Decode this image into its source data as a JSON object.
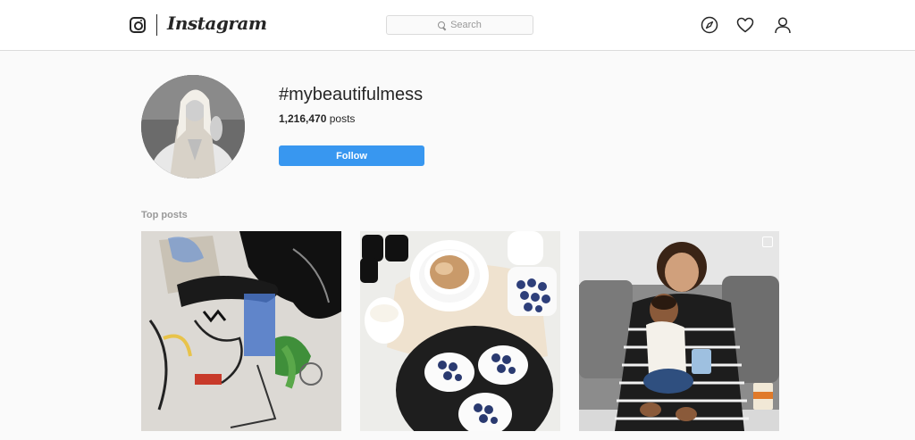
{
  "header": {
    "brand": "Instagram",
    "search_placeholder": "Search",
    "icons": [
      "instagram-logo-icon",
      "compass-icon",
      "heart-icon",
      "profile-icon"
    ]
  },
  "hashtag": {
    "title": "#mybeautifulmess",
    "post_count": "1,216,470",
    "post_count_suffix": " posts",
    "follow_label": "Follow"
  },
  "top_posts": {
    "label": "Top posts",
    "items": [
      {
        "kind": "abstract-painting"
      },
      {
        "kind": "coffee-and-pavlovas"
      },
      {
        "kind": "mother-and-baby",
        "multi": true
      }
    ]
  },
  "colors": {
    "accent": "#3897f0",
    "background": "#fafafa",
    "border": "#dbdbdb"
  }
}
